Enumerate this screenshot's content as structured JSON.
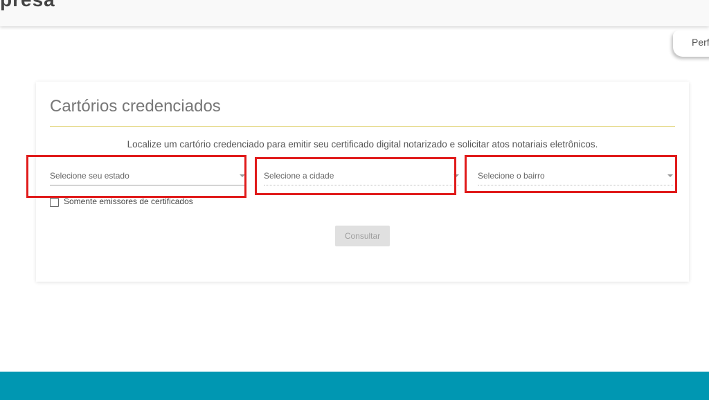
{
  "header": {
    "brand_partial": "presa",
    "profile_tab_label": "Perf"
  },
  "card": {
    "title": "Cartórios credenciados",
    "description": "Localize um cartório credenciado para emitir seu certificado digital notarizado e solicitar atos notariais eletrônicos.",
    "selects": {
      "estado_placeholder": "Selecione seu estado",
      "cidade_placeholder": "Selecione a cidade",
      "bairro_placeholder": "Selecione o bairro"
    },
    "checkbox_label": "Somente emissores de certificados",
    "checkbox_checked": false,
    "consult_button": "Consultar"
  },
  "colors": {
    "accent_rule": "#e2d47a",
    "footer": "#0097b2",
    "highlight": "#e01b1b",
    "button_disabled_bg": "#e0e0e0"
  },
  "icons": [
    "dropdown-arrow-icon",
    "checkbox-icon"
  ]
}
